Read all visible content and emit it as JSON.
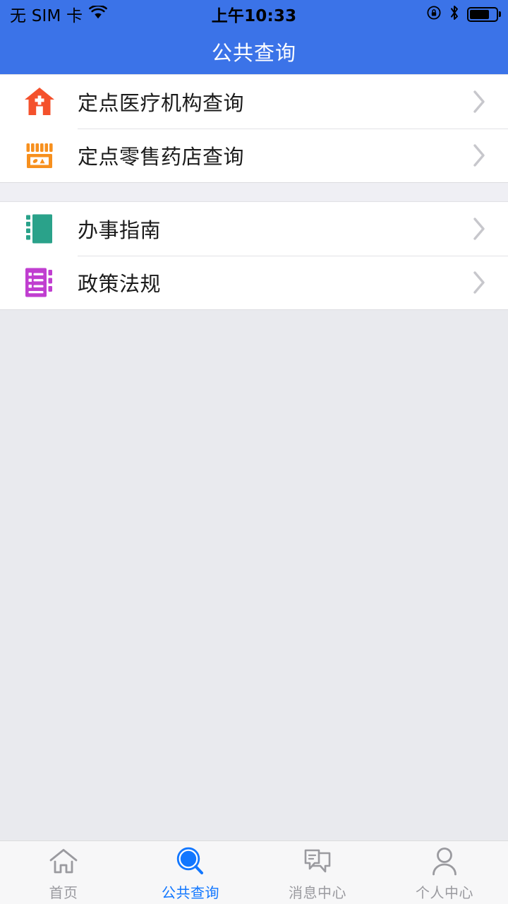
{
  "status_bar": {
    "carrier": "无 SIM 卡",
    "wifi_icon": "wifi-icon",
    "time": "上午10:33",
    "rotation_lock_icon": "rotation-lock-icon",
    "bluetooth_icon": "bluetooth-icon",
    "battery_icon": "battery-icon",
    "battery_level": "76"
  },
  "nav": {
    "title": "公共查询"
  },
  "colors": {
    "header_blue": "#3b73e8",
    "accent_blue": "#1277ff",
    "page_background": "#e9eaee",
    "group_gap": "#efeff4",
    "row_background": "#ffffff",
    "divider": "#e2e2e6",
    "chevron": "#c7c7cc",
    "tab_inactive": "#9a9a9f",
    "tabbar_background": "#f7f7f8",
    "icon_hospital": "#f4512c",
    "icon_pharmacy": "#f7901e",
    "icon_guide": "#2aa28a",
    "icon_policy": "#c03ed0"
  },
  "groups": [
    {
      "rows": [
        {
          "label": "定点医疗机构查询",
          "icon": "hospital-icon",
          "chevron": "chevron-right-icon"
        },
        {
          "label": "定点零售药店查询",
          "icon": "pharmacy-icon",
          "chevron": "chevron-right-icon"
        }
      ]
    },
    {
      "rows": [
        {
          "label": "办事指南",
          "icon": "guide-book-icon",
          "chevron": "chevron-right-icon"
        },
        {
          "label": "政策法规",
          "icon": "policy-book-icon",
          "chevron": "chevron-right-icon"
        }
      ]
    }
  ],
  "tabs": [
    {
      "label": "首页",
      "icon": "home-icon",
      "active": false
    },
    {
      "label": "公共查询",
      "icon": "search-icon",
      "active": true
    },
    {
      "label": "消息中心",
      "icon": "chat-icon",
      "active": false
    },
    {
      "label": "个人中心",
      "icon": "person-icon",
      "active": false
    }
  ]
}
